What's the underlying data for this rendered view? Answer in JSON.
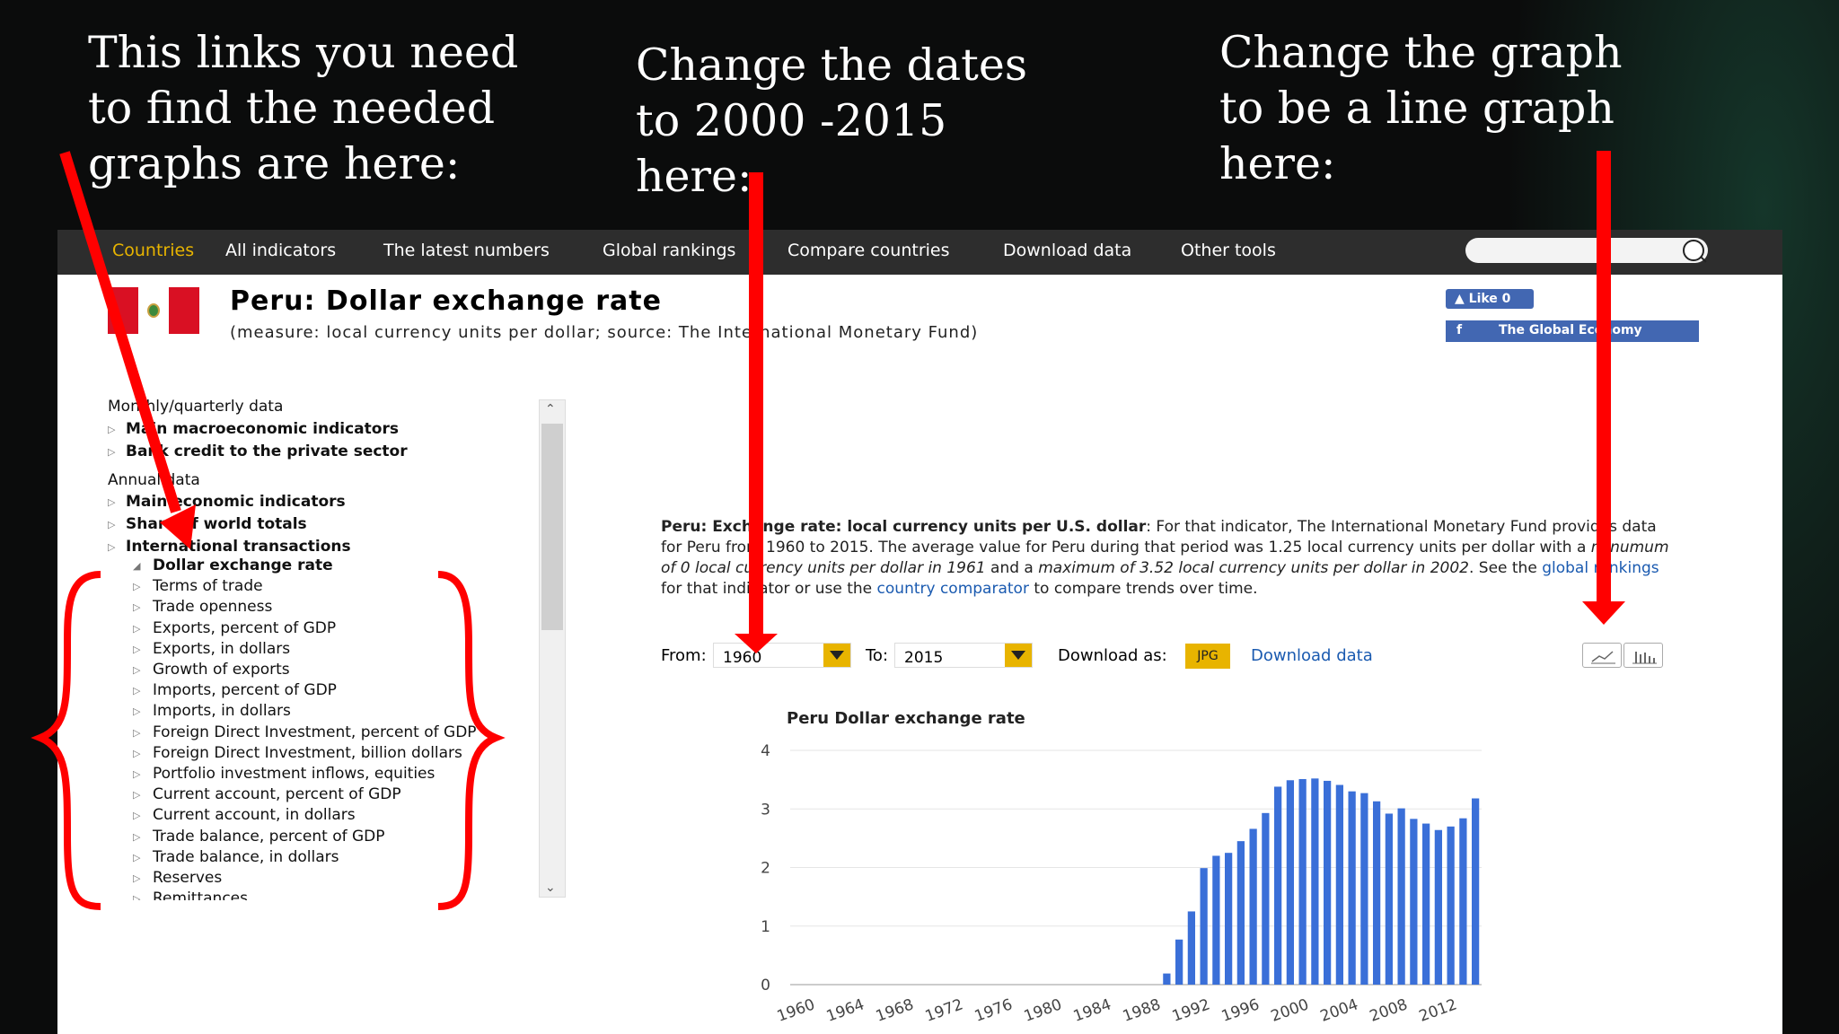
{
  "annotations": {
    "left": "This links you need to find the needed graphs are here:",
    "middle": "Change the dates to 2000 -2015 here:",
    "right": "Change the graph to be a line graph here:"
  },
  "nav": {
    "items": [
      "Countries",
      "All indicators",
      "The latest numbers",
      "Global rankings",
      "Compare countries",
      "Download data",
      "Other tools"
    ]
  },
  "header": {
    "title": "Peru: Dollar exchange rate",
    "subtitle": "(measure: local currency units per dollar; source: The International Monetary Fund)"
  },
  "social": {
    "like": "Like 0",
    "page": "The Global Economy"
  },
  "sidebar": {
    "monthly_header": "Monthly/quarterly data",
    "monthly_items": [
      "Main macroeconomic indicators",
      "Bank credit to the private sector"
    ],
    "annual_header": "Annual data",
    "annual_items": [
      "Main economic indicators",
      "Share of world totals",
      "International transactions"
    ],
    "sub_items": [
      "Dollar exchange rate",
      "Terms of trade",
      "Trade openness",
      "Exports, percent of GDP",
      "Exports, in dollars",
      "Growth of exports",
      "Imports, percent of GDP",
      "Imports, in dollars",
      "Foreign Direct Investment, percent of GDP",
      "Foreign Direct Investment, billion dollars",
      "Portfolio investment inflows, equities",
      "Current account, percent of GDP",
      "Current account, in dollars",
      "Trade balance, percent of GDP",
      "Trade balance, in dollars",
      "Reserves",
      "Remittances"
    ]
  },
  "description": {
    "lead": "Peru: Exchange rate: local currency units per U.S. dollar",
    "p1": ": For that indicator, The International Monetary Fund provides data for Peru from 1960 to 2015. The average value for Peru during that period was 1.25 local currency units per dollar with a ",
    "min": "minumum of 0 local currency units per dollar in 1961",
    "p2": " and a ",
    "max": "maximum of 3.52 local currency units per dollar in 2002",
    "p3": ". See the ",
    "link1": "global rankings",
    "p4": " for that indicator or use the ",
    "link2": "country comparator",
    "p5": " to compare trends over time."
  },
  "controls": {
    "from_label": "From:",
    "from_value": "1960",
    "to_label": "To:",
    "to_value": "2015",
    "download_as": "Download as:",
    "jpg": "JPG",
    "download_data": "Download data"
  },
  "colors": {
    "accent": "#e8b400",
    "bar": "#3a6fd8",
    "annotation": "#ff0000",
    "nav": "#2d2d2d"
  },
  "chart_data": {
    "type": "bar",
    "title": "Peru Dollar exchange rate",
    "ylim": [
      0,
      4
    ],
    "yticks": [
      0,
      1,
      2,
      3,
      4
    ],
    "xticks": [
      "1960",
      "1964",
      "1968",
      "1972",
      "1976",
      "1980",
      "1984",
      "1988",
      "1992",
      "1996",
      "2000",
      "2004",
      "2008",
      "2012"
    ],
    "x": [
      1960,
      1961,
      1962,
      1963,
      1964,
      1965,
      1966,
      1967,
      1968,
      1969,
      1970,
      1971,
      1972,
      1973,
      1974,
      1975,
      1976,
      1977,
      1978,
      1979,
      1980,
      1981,
      1982,
      1983,
      1984,
      1985,
      1986,
      1987,
      1988,
      1989,
      1990,
      1991,
      1992,
      1993,
      1994,
      1995,
      1996,
      1997,
      1998,
      1999,
      2000,
      2001,
      2002,
      2003,
      2004,
      2005,
      2006,
      2007,
      2008,
      2009,
      2010,
      2011,
      2012,
      2013,
      2014,
      2015
    ],
    "values": [
      0,
      0,
      0,
      0,
      0,
      0,
      0,
      0,
      0,
      0,
      0,
      0,
      0,
      0,
      0,
      0,
      0,
      0,
      0,
      0,
      0,
      0,
      0,
      0,
      0,
      0,
      0,
      0,
      0,
      0,
      0.19,
      0.77,
      1.25,
      1.99,
      2.2,
      2.25,
      2.45,
      2.66,
      2.93,
      3.38,
      3.49,
      3.51,
      3.52,
      3.48,
      3.41,
      3.3,
      3.27,
      3.13,
      2.92,
      3.01,
      2.83,
      2.75,
      2.64,
      2.7,
      2.84,
      3.18
    ]
  }
}
